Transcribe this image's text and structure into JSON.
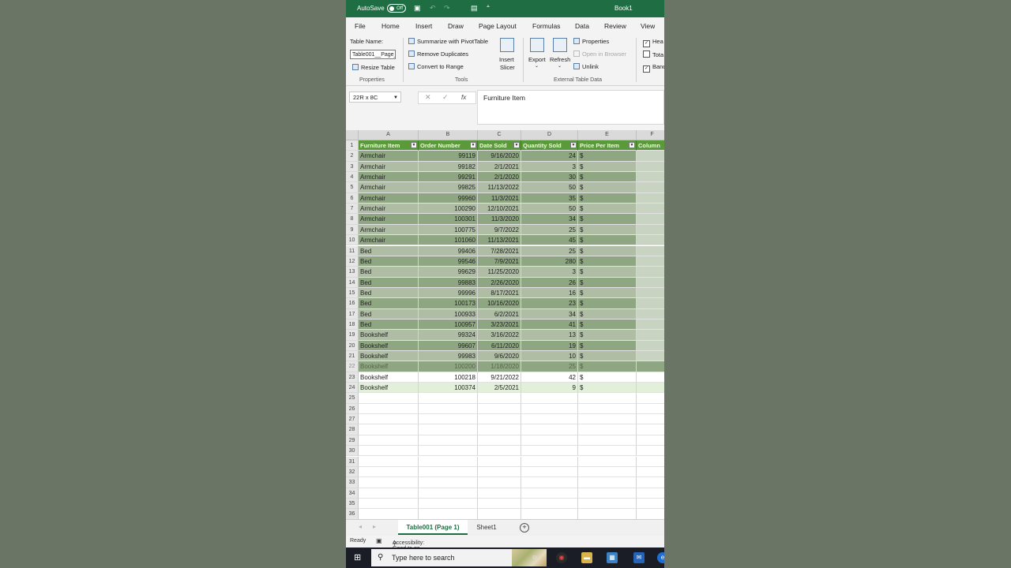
{
  "titlebar": {
    "autosave_label": "AutoSave",
    "toggle_state": "Off",
    "doc_title": "Book1"
  },
  "menu": [
    "File",
    "Home",
    "Insert",
    "Draw",
    "Page Layout",
    "Formulas",
    "Data",
    "Review",
    "View"
  ],
  "ribbon": {
    "properties": {
      "table_name_label": "Table Name:",
      "table_name_value": "Table001__Page_",
      "resize": "Resize Table",
      "group": "Properties"
    },
    "tools": {
      "summarize": "Summarize with PivotTable",
      "remove_duplicates": "Remove Duplicates",
      "convert": "Convert to Range",
      "group": "Tools"
    },
    "slicer": {
      "line1": "Insert",
      "line2": "Slicer"
    },
    "external": {
      "export": "Export",
      "refresh": "Refresh",
      "properties": "Properties",
      "open_browser": "Open in Browser",
      "unlink": "Unlink",
      "group": "External Table Data"
    },
    "style_options": {
      "header": "Hea",
      "total": "Tota",
      "banded": "Band"
    }
  },
  "formula_bar": {
    "name_box": "22R x 8C",
    "cancel": "✕",
    "enter": "✓",
    "fx": "fx",
    "content": "Furniture Item"
  },
  "grid": {
    "columns": [
      "A",
      "B",
      "C",
      "D",
      "E",
      "F"
    ],
    "headers": [
      "Furniture Item",
      "Order Number",
      "Date Sold",
      "Quantity Sold",
      "Price Per Item",
      "Column"
    ],
    "rows": [
      [
        "Armchair",
        "99119",
        "9/16/2020",
        "24",
        "$"
      ],
      [
        "Armchair",
        "99182",
        "2/1/2021",
        "3",
        "$"
      ],
      [
        "Armchair",
        "99291",
        "2/1/2020",
        "30",
        "$"
      ],
      [
        "Armchair",
        "99825",
        "11/13/2022",
        "50",
        "$"
      ],
      [
        "Armchair",
        "99960",
        "11/3/2021",
        "35",
        "$"
      ],
      [
        "Armchair",
        "100290",
        "12/10/2021",
        "50",
        "$"
      ],
      [
        "Armchair",
        "100301",
        "11/3/2020",
        "34",
        "$"
      ],
      [
        "Armchair",
        "100775",
        "9/7/2022",
        "25",
        "$"
      ],
      [
        "Armchair",
        "101060",
        "11/13/2021",
        "45",
        "$"
      ],
      [
        "Bed",
        "99406",
        "7/28/2021",
        "25",
        "$"
      ],
      [
        "Bed",
        "99546",
        "7/9/2021",
        "280",
        "$"
      ],
      [
        "Bed",
        "99629",
        "11/25/2020",
        "3",
        "$"
      ],
      [
        "Bed",
        "99883",
        "2/26/2020",
        "26",
        "$"
      ],
      [
        "Bed",
        "99996",
        "8/17/2021",
        "16",
        "$"
      ],
      [
        "Bed",
        "100173",
        "10/16/2020",
        "23",
        "$"
      ],
      [
        "Bed",
        "100933",
        "6/2/2021",
        "34",
        "$"
      ],
      [
        "Bed",
        "100957",
        "3/23/2021",
        "41",
        "$"
      ],
      [
        "Bookshelf",
        "99324",
        "3/16/2022",
        "13",
        "$"
      ],
      [
        "Bookshelf",
        "99607",
        "6/11/2020",
        "19",
        "$"
      ],
      [
        "Bookshelf",
        "99983",
        "9/6/2020",
        "10",
        "$"
      ],
      [
        "Bookshelf",
        "100200",
        "1/18/2020",
        "25",
        "$"
      ],
      [
        "Bookshelf",
        "100218",
        "9/21/2022",
        "42",
        "$"
      ],
      [
        "Bookshelf",
        "100374",
        "2/5/2021",
        "9",
        "$"
      ]
    ],
    "empty_row_numbers": [
      "25",
      "26",
      "27",
      "28",
      "29",
      "30",
      "31",
      "32",
      "33",
      "34",
      "35",
      "36"
    ]
  },
  "sheets": {
    "active": "Table001 (Page 1)",
    "other": "Sheet1",
    "add": "+"
  },
  "status": {
    "ready": "Ready",
    "accessibility": "Accessibility: Good to go"
  },
  "taskbar": {
    "search_placeholder": "Type here to search"
  },
  "colors": {
    "excel_green": "#1f6e43",
    "table_header": "#5b9a3a",
    "band_dark": "#8fa682",
    "band_light": "#aebda4"
  }
}
